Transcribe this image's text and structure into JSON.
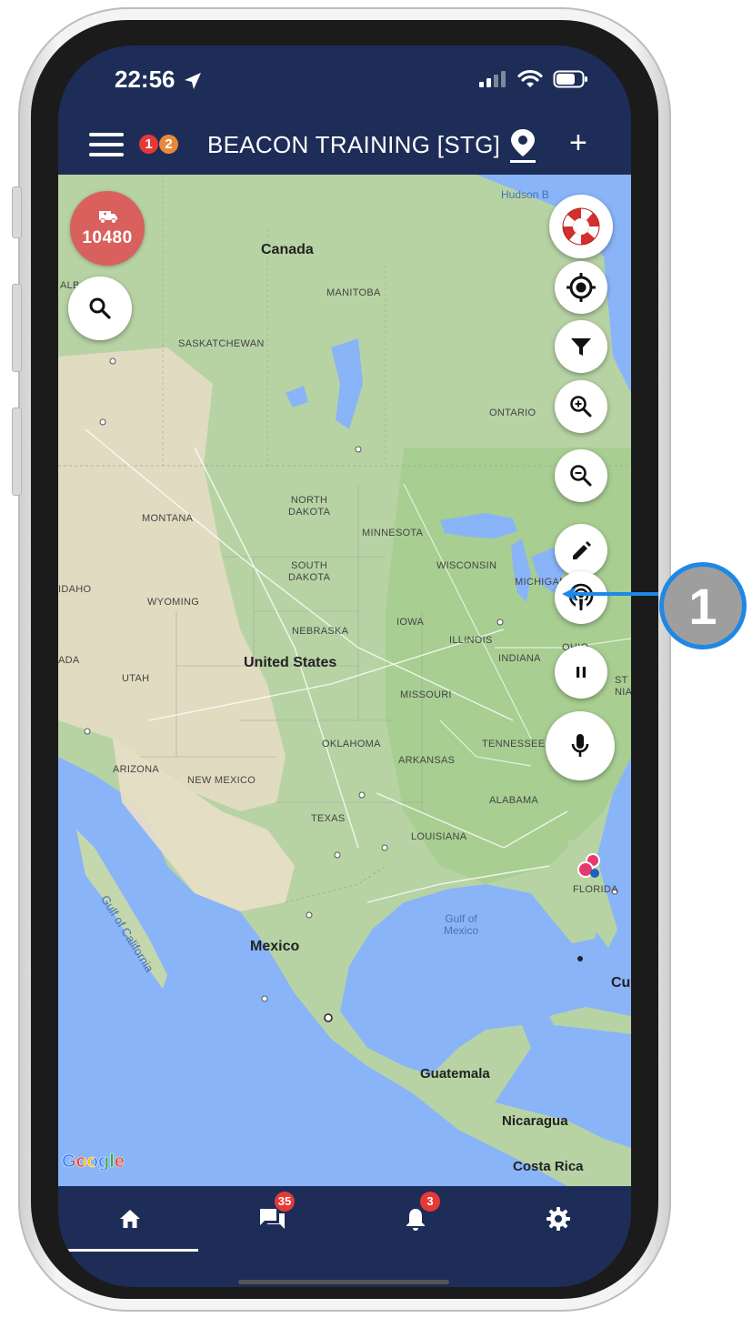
{
  "status_bar": {
    "time": "22:56"
  },
  "header": {
    "title": "BEACON TRAINING [STG]",
    "badge_red": "1",
    "badge_orange": "2"
  },
  "map": {
    "incident_count": "10480",
    "labels": {
      "hudson_bay": "Hudson B",
      "canada": "Canada",
      "manitoba": "MANITOBA",
      "saskatchewan": "SASKATCHEWAN",
      "alberta": "ALB",
      "ontario": "ONTARIO",
      "north_dakota": "NORTH\nDAKOTA",
      "montana": "MONTANA",
      "minnesota": "MINNESOTA",
      "south_dakota": "SOUTH\nDAKOTA",
      "wisconsin": "WISCONSIN",
      "michigan": "MICHIGAN",
      "idaho": "IDAHO",
      "wyoming": "WYOMING",
      "iowa": "IOWA",
      "nebraska": "NEBRASKA",
      "illinois": "ILLINOIS",
      "indiana": "INDIANA",
      "ohio": "OHIO",
      "nevada": "ADA",
      "utah": "UTAH",
      "united_states": "United States",
      "missouri": "MISSOURI",
      "oklahoma": "OKLAHOMA",
      "tennessee": "TENNESSEE",
      "arkansas": "ARKANSAS",
      "arizona": "ARIZONA",
      "new_mexico": "NEW MEXICO",
      "alabama": "ALABAMA",
      "texas": "TEXAS",
      "louisiana": "LOUISIANA",
      "florida": "FLORIDA",
      "gulf_of_california": "Gulf of California",
      "gulf_of_mexico": "Gulf of\nMexico",
      "mexico": "Mexico",
      "cuba": "Cu",
      "guatemala": "Guatemala",
      "nicaragua": "Nicaragua",
      "costa_rica": "Costa Rica",
      "east_state": "ST\nNIA"
    },
    "google_logo": "Google"
  },
  "nav": {
    "messages_badge": "35",
    "notifications_badge": "3"
  },
  "callout": {
    "number": "1"
  },
  "colors": {
    "navy": "#1d2d57",
    "incident_red": "#d9605c",
    "lifebuoy_red": "#d32f2f",
    "badge_red": "#e53935",
    "badge_orange": "#e8893a",
    "callout_blue": "#1e88e5",
    "callout_grey": "#9e9e9e"
  }
}
